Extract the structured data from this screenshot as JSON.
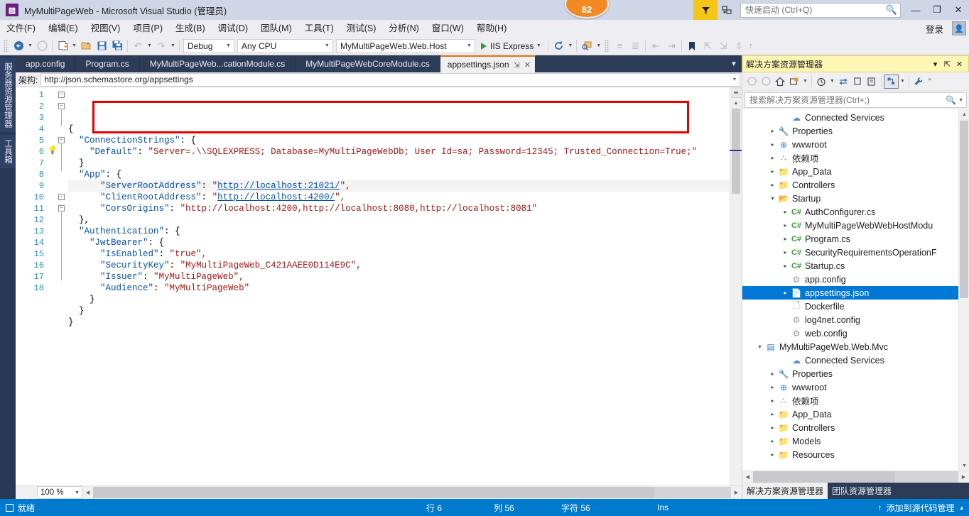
{
  "titlebar": {
    "app_title": "MyMultiPageWeb - Microsoft Visual Studio (管理员)",
    "logo_glyph": "▨",
    "badge_count": "82",
    "quick_launch_placeholder": "快速启动 (Ctrl+Q)",
    "quick_launch_value": "",
    "minimize": "—",
    "maximize": "❐",
    "close": "✕"
  },
  "menubar": {
    "items": [
      {
        "label": "文件(F)"
      },
      {
        "label": "编辑(E)"
      },
      {
        "label": "视图(V)"
      },
      {
        "label": "项目(P)"
      },
      {
        "label": "生成(B)"
      },
      {
        "label": "调试(D)"
      },
      {
        "label": "团队(M)"
      },
      {
        "label": "工具(T)"
      },
      {
        "label": "测试(S)"
      },
      {
        "label": "分析(N)"
      },
      {
        "label": "窗口(W)"
      },
      {
        "label": "帮助(H)"
      }
    ],
    "signin_label": "登录"
  },
  "toolbar": {
    "navigate_back": "⬅",
    "navigate_forward": "➡",
    "new_project": "🗋",
    "open_file": "📂",
    "save": "💾",
    "save_all": "🖫",
    "undo": "↶",
    "redo": "↷",
    "config_value": "Debug",
    "platform_value": "Any CPU",
    "startup_project_value": "MyMultiPageWeb.Web.Host",
    "run_label": "IIS Express",
    "refresh": "↻",
    "find_in_file": "🔍",
    "comment": "≡",
    "uncomment": "≣",
    "outdent": "⇤",
    "indent": "⇥",
    "bookmark": "🔖",
    "bm_prev": "⇱",
    "bm_next": "⇲",
    "bm_clear": "⇳"
  },
  "leftdock": {
    "tabs": [
      {
        "label": "服务器资源管理器"
      },
      {
        "label": "工具箱"
      }
    ]
  },
  "editor": {
    "tabs": [
      {
        "label": "app.config",
        "active": false
      },
      {
        "label": "Program.cs",
        "active": false
      },
      {
        "label": "MyMultiPageWeb...cationModule.cs",
        "active": false
      },
      {
        "label": "MyMultiPageWebCoreModule.cs",
        "active": false
      },
      {
        "label": "appsettings.json",
        "active": true
      }
    ],
    "tab_pin_glyph": "⇲",
    "tab_close_glyph": "✕",
    "tab_overflow_glyph": "▼",
    "navbar_label": "架构:",
    "navbar_value": "http://json.schemastore.org/appsettings",
    "zoom_level": "100 %",
    "line_numbers": [
      "1",
      "2",
      "3",
      "4",
      "5",
      "6",
      "7",
      "8",
      "9",
      "10",
      "11",
      "12",
      "13",
      "14",
      "15",
      "16",
      "17",
      "18"
    ],
    "code_lines": [
      {
        "n": 1,
        "segments": [
          {
            "t": "{",
            "c": "k-punct"
          }
        ]
      },
      {
        "n": 2,
        "segments": [
          {
            "t": "  ",
            "c": "k-punct"
          },
          {
            "t": "\"ConnectionStrings\"",
            "c": "k-prop"
          },
          {
            "t": ": {",
            "c": "k-punct"
          }
        ]
      },
      {
        "n": 3,
        "segments": [
          {
            "t": "    ",
            "c": "k-punct"
          },
          {
            "t": "\"Default\"",
            "c": "k-prop"
          },
          {
            "t": ": ",
            "c": "k-punct"
          },
          {
            "t": "\"Server=.\\\\SQLEXPRESS; Database=MyMultiPageWebDb; User Id=sa; Password=12345; Trusted_Connection=True;\"",
            "c": "k-str"
          }
        ]
      },
      {
        "n": 4,
        "segments": [
          {
            "t": "  }",
            "c": "k-punct"
          }
        ]
      },
      {
        "n": 5,
        "segments": [
          {
            "t": "  ",
            "c": "k-punct"
          },
          {
            "t": "\"App\"",
            "c": "k-prop"
          },
          {
            "t": ": {",
            "c": "k-punct"
          }
        ]
      },
      {
        "n": 6,
        "segments": [
          {
            "t": "      ",
            "c": "k-punct"
          },
          {
            "t": "\"ServerRootAddress\"",
            "c": "k-prop"
          },
          {
            "t": ": ",
            "c": "k-punct"
          },
          {
            "t": "\"",
            "c": "k-str"
          },
          {
            "t": "http://localhost:21021/",
            "c": "k-link"
          },
          {
            "t": "\",",
            "c": "k-str"
          }
        ]
      },
      {
        "n": 7,
        "segments": [
          {
            "t": "      ",
            "c": "k-punct"
          },
          {
            "t": "\"ClientRootAddress\"",
            "c": "k-prop"
          },
          {
            "t": ": ",
            "c": "k-punct"
          },
          {
            "t": "\"",
            "c": "k-str"
          },
          {
            "t": "http://localhost:4200/",
            "c": "k-link"
          },
          {
            "t": "\",",
            "c": "k-str"
          }
        ]
      },
      {
        "n": 8,
        "segments": [
          {
            "t": "      ",
            "c": "k-punct"
          },
          {
            "t": "\"CorsOrigins\"",
            "c": "k-prop"
          },
          {
            "t": ": ",
            "c": "k-punct"
          },
          {
            "t": "\"http://localhost:4200,http://localhost:8080,http://localhost:8081\"",
            "c": "k-str"
          }
        ]
      },
      {
        "n": 9,
        "segments": [
          {
            "t": "  },",
            "c": "k-punct"
          }
        ]
      },
      {
        "n": 10,
        "segments": [
          {
            "t": "  ",
            "c": "k-punct"
          },
          {
            "t": "\"Authentication\"",
            "c": "k-prop"
          },
          {
            "t": ": {",
            "c": "k-punct"
          }
        ]
      },
      {
        "n": 11,
        "segments": [
          {
            "t": "    ",
            "c": "k-punct"
          },
          {
            "t": "\"JwtBearer\"",
            "c": "k-prop"
          },
          {
            "t": ": {",
            "c": "k-punct"
          }
        ]
      },
      {
        "n": 12,
        "segments": [
          {
            "t": "      ",
            "c": "k-punct"
          },
          {
            "t": "\"IsEnabled\"",
            "c": "k-prop"
          },
          {
            "t": ": ",
            "c": "k-punct"
          },
          {
            "t": "\"true\",",
            "c": "k-str"
          }
        ]
      },
      {
        "n": 13,
        "segments": [
          {
            "t": "      ",
            "c": "k-punct"
          },
          {
            "t": "\"SecurityKey\"",
            "c": "k-prop"
          },
          {
            "t": ": ",
            "c": "k-punct"
          },
          {
            "t": "\"MyMultiPageWeb_C421AAEE0D114E9C\",",
            "c": "k-str"
          }
        ]
      },
      {
        "n": 14,
        "segments": [
          {
            "t": "      ",
            "c": "k-punct"
          },
          {
            "t": "\"Issuer\"",
            "c": "k-prop"
          },
          {
            "t": ": ",
            "c": "k-punct"
          },
          {
            "t": "\"MyMultiPageWeb\",",
            "c": "k-str"
          }
        ]
      },
      {
        "n": 15,
        "segments": [
          {
            "t": "      ",
            "c": "k-punct"
          },
          {
            "t": "\"Audience\"",
            "c": "k-prop"
          },
          {
            "t": ": ",
            "c": "k-punct"
          },
          {
            "t": "\"MyMultiPageWeb\"",
            "c": "k-str"
          }
        ]
      },
      {
        "n": 16,
        "segments": [
          {
            "t": "    }",
            "c": "k-punct"
          }
        ]
      },
      {
        "n": 17,
        "segments": [
          {
            "t": "  }",
            "c": "k-punct"
          }
        ]
      },
      {
        "n": 18,
        "segments": [
          {
            "t": "}",
            "c": "k-punct"
          }
        ]
      }
    ],
    "highlight_annotation": "red-rectangle around ConnectionStrings block (lines 2-4)"
  },
  "solution_explorer": {
    "title": "解决方案资源管理器",
    "title_dropdown": "▾",
    "title_pin": "⇱",
    "title_close": "✕",
    "toolbar": {
      "back": "◐",
      "forward": "◑",
      "home": "⌂",
      "sync": "⛁",
      "pending_changes": "◷",
      "refresh": "⇆",
      "collapse_all": "⊡",
      "show_all_files": "⊞",
      "view_selector": "⬔",
      "properties": "🔧",
      "overflow": "\""
    },
    "search_placeholder": "搜索解决方案资源管理器(Ctrl+;)",
    "search_value": "",
    "search_icon": "⌕",
    "tree": [
      {
        "label": "Connected Services",
        "indent": 3,
        "arrow": "",
        "icon": "cloud",
        "selected": false
      },
      {
        "label": "Properties",
        "indent": 2,
        "arrow": "▷",
        "icon": "wrench",
        "selected": false
      },
      {
        "label": "wwwroot",
        "indent": 2,
        "arrow": "▷",
        "icon": "globe",
        "selected": false
      },
      {
        "label": "依赖项",
        "indent": 2,
        "arrow": "▷",
        "icon": "deps",
        "selected": false
      },
      {
        "label": "App_Data",
        "indent": 2,
        "arrow": "▷",
        "icon": "folder",
        "selected": false
      },
      {
        "label": "Controllers",
        "indent": 2,
        "arrow": "▷",
        "icon": "folder",
        "selected": false
      },
      {
        "label": "Startup",
        "indent": 2,
        "arrow": "◢",
        "icon": "folder-open",
        "selected": false
      },
      {
        "label": "AuthConfigurer.cs",
        "indent": 3,
        "arrow": "▷",
        "icon": "cs",
        "selected": false
      },
      {
        "label": "MyMultiPageWebWebHostModu",
        "indent": 3,
        "arrow": "▷",
        "icon": "cs",
        "selected": false
      },
      {
        "label": "Program.cs",
        "indent": 3,
        "arrow": "▷",
        "icon": "cs",
        "selected": false
      },
      {
        "label": "SecurityRequirementsOperationF",
        "indent": 3,
        "arrow": "▷",
        "icon": "cs",
        "selected": false
      },
      {
        "label": "Startup.cs",
        "indent": 3,
        "arrow": "▷",
        "icon": "cs",
        "selected": false
      },
      {
        "label": "app.config",
        "indent": 3,
        "arrow": "",
        "icon": "cfg",
        "selected": false
      },
      {
        "label": "appsettings.json",
        "indent": 3,
        "arrow": "▷",
        "icon": "json",
        "selected": true
      },
      {
        "label": "Dockerfile",
        "indent": 3,
        "arrow": "",
        "icon": "doc",
        "selected": false
      },
      {
        "label": "log4net.config",
        "indent": 3,
        "arrow": "",
        "icon": "cfg",
        "selected": false
      },
      {
        "label": "web.config",
        "indent": 3,
        "arrow": "",
        "icon": "cfg",
        "selected": false
      },
      {
        "label": "MyMultiPageWeb.Web.Mvc",
        "indent": 1,
        "arrow": "◢",
        "icon": "proj",
        "selected": false
      },
      {
        "label": "Connected Services",
        "indent": 3,
        "arrow": "",
        "icon": "cloud",
        "selected": false
      },
      {
        "label": "Properties",
        "indent": 2,
        "arrow": "▷",
        "icon": "wrench",
        "selected": false
      },
      {
        "label": "wwwroot",
        "indent": 2,
        "arrow": "▷",
        "icon": "globe",
        "selected": false
      },
      {
        "label": "依赖项",
        "indent": 2,
        "arrow": "▷",
        "icon": "deps",
        "selected": false
      },
      {
        "label": "App_Data",
        "indent": 2,
        "arrow": "▷",
        "icon": "folder",
        "selected": false
      },
      {
        "label": "Controllers",
        "indent": 2,
        "arrow": "▷",
        "icon": "folder",
        "selected": false
      },
      {
        "label": "Models",
        "indent": 2,
        "arrow": "▷",
        "icon": "folder",
        "selected": false
      },
      {
        "label": "Resources",
        "indent": 2,
        "arrow": "▷",
        "icon": "folder",
        "selected": false
      }
    ],
    "bottom_tabs": [
      {
        "label": "解决方案资源管理器",
        "active": true
      },
      {
        "label": "团队资源管理器",
        "active": false
      }
    ]
  },
  "statusbar": {
    "state": "就绪",
    "line_label": "行 6",
    "column_label": "列 56",
    "char_label": "字符 56",
    "insert_mode": "Ins",
    "source_control": "添加到源代码管理",
    "source_control_arrow": "↑",
    "expand_glyph": "▴"
  }
}
